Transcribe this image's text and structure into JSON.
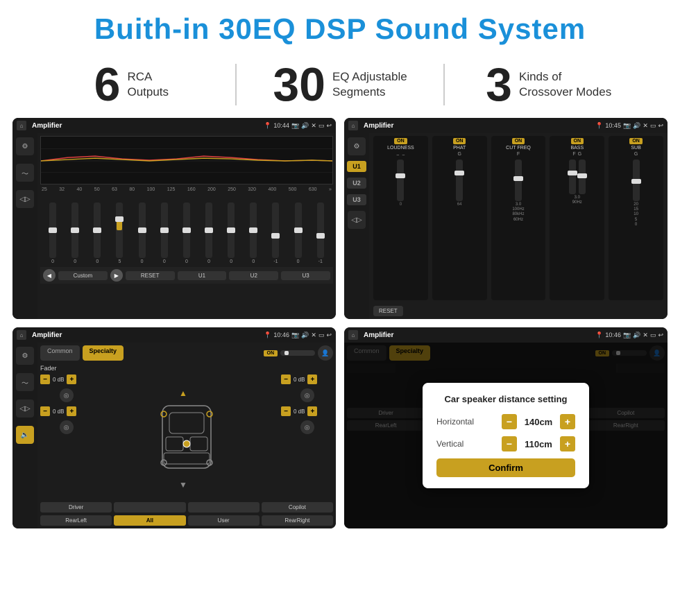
{
  "page": {
    "title": "Buith-in 30EQ DSP Sound System",
    "stats": [
      {
        "number": "6",
        "text": "RCA\nOutputs"
      },
      {
        "number": "30",
        "text": "EQ Adjustable\nSegments"
      },
      {
        "number": "3",
        "text": "Kinds of\nCrossover Modes"
      }
    ],
    "screens": [
      {
        "id": "screen1",
        "title": "Amplifier",
        "time": "10:44",
        "type": "eq"
      },
      {
        "id": "screen2",
        "title": "Amplifier",
        "time": "10:45",
        "type": "crossover"
      },
      {
        "id": "screen3",
        "title": "Amplifier",
        "time": "10:46",
        "type": "speaker"
      },
      {
        "id": "screen4",
        "title": "Amplifier",
        "time": "10:46",
        "type": "distance"
      }
    ],
    "eq": {
      "frequencies": [
        "25",
        "32",
        "40",
        "50",
        "63",
        "80",
        "100",
        "125",
        "160",
        "200",
        "250",
        "320",
        "400",
        "500",
        "630"
      ],
      "values": [
        "0",
        "0",
        "0",
        "5",
        "0",
        "0",
        "0",
        "0",
        "0",
        "0",
        "-1",
        "0",
        "-1"
      ],
      "preset": "Custom",
      "buttons": [
        "RESET",
        "U1",
        "U2",
        "U3"
      ]
    },
    "crossover": {
      "units": [
        "U1",
        "U2",
        "U3"
      ],
      "modules": [
        "LOUDNESS",
        "PHAT",
        "CUT FREQ",
        "BASS",
        "SUB"
      ]
    },
    "speaker": {
      "tabs": [
        "Common",
        "Specialty"
      ],
      "fader_label": "Fader",
      "fader_on": "ON",
      "buttons": [
        "Driver",
        "",
        "",
        "Copilot",
        "RearLeft",
        "All",
        "User",
        "RearRight"
      ]
    },
    "distance_dialog": {
      "title": "Car speaker distance setting",
      "horizontal_label": "Horizontal",
      "horizontal_value": "140cm",
      "vertical_label": "Vertical",
      "vertical_value": "110cm",
      "confirm_label": "Confirm"
    }
  }
}
